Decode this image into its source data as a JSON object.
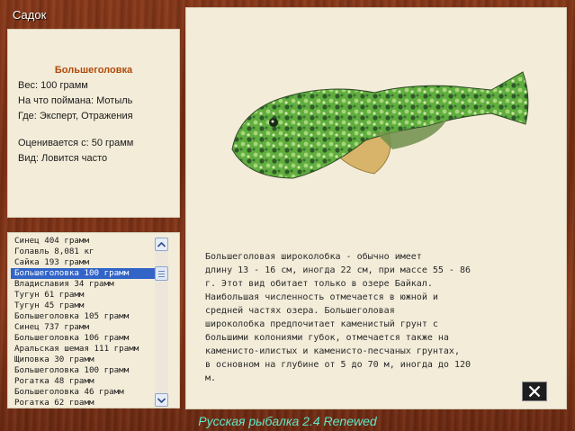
{
  "window": {
    "title": "Садок"
  },
  "fish_info": {
    "name": "Большеголовка",
    "weight": "Вес: 100 грамм",
    "bait": "На что поймана: Мотыль",
    "where": "Где: Эксперт, Отражения",
    "value": "Оценивается с: 50 грамм",
    "kind": "Вид: Ловится часто"
  },
  "catch_list": {
    "items": [
      "Синец 404 грамм",
      "Голавль 8,081 кг",
      "Сайка 193 грамм",
      "Большеголовка 100 грамм",
      "Владиславия 34 грамм",
      "Тугун 61 грамм",
      "Тугун 45 грамм",
      "Большеголовка 105 грамм",
      "Синец 737 грамм",
      "Большеголовка 106 грамм",
      "Аральская шемая 111 грамм",
      "Щиповка 30 грамм",
      "Большеголовка 100 грамм",
      "Рогатка 48 грамм",
      "Большеголовка 46 грамм",
      "Рогатка 62 грамм"
    ],
    "selected_index": 3
  },
  "description": "Большеголовая широколобка - обычно имеет\nдлину 13 - 16 см, иногда 22 см, при массе 55 - 86\nг. Этот вид обитает только в озере Байкал.\nНаибольшая численность отмечается в южной и\nсредней частях озера. Большеголовая\nшироколобка предпочитает каменистый грунт с\nбольшими колониями губок, отмечается также на\nкаменисто-илистых и каменисто-песчаных грунтах,\nв основном на глубине от 5 до 70 м, иногда до 120\nм.",
  "footer": {
    "text": "Русская рыбалка 2.4 Renewed"
  },
  "colors": {
    "accent_name": "#b04a0a",
    "panel": "#f3ecd9",
    "selection": "#3264c8",
    "footer": "#5fe8c8"
  },
  "icons": {
    "scroll_up": "chevron-up-icon",
    "scroll_down": "chevron-down-icon",
    "close": "close-icon"
  }
}
